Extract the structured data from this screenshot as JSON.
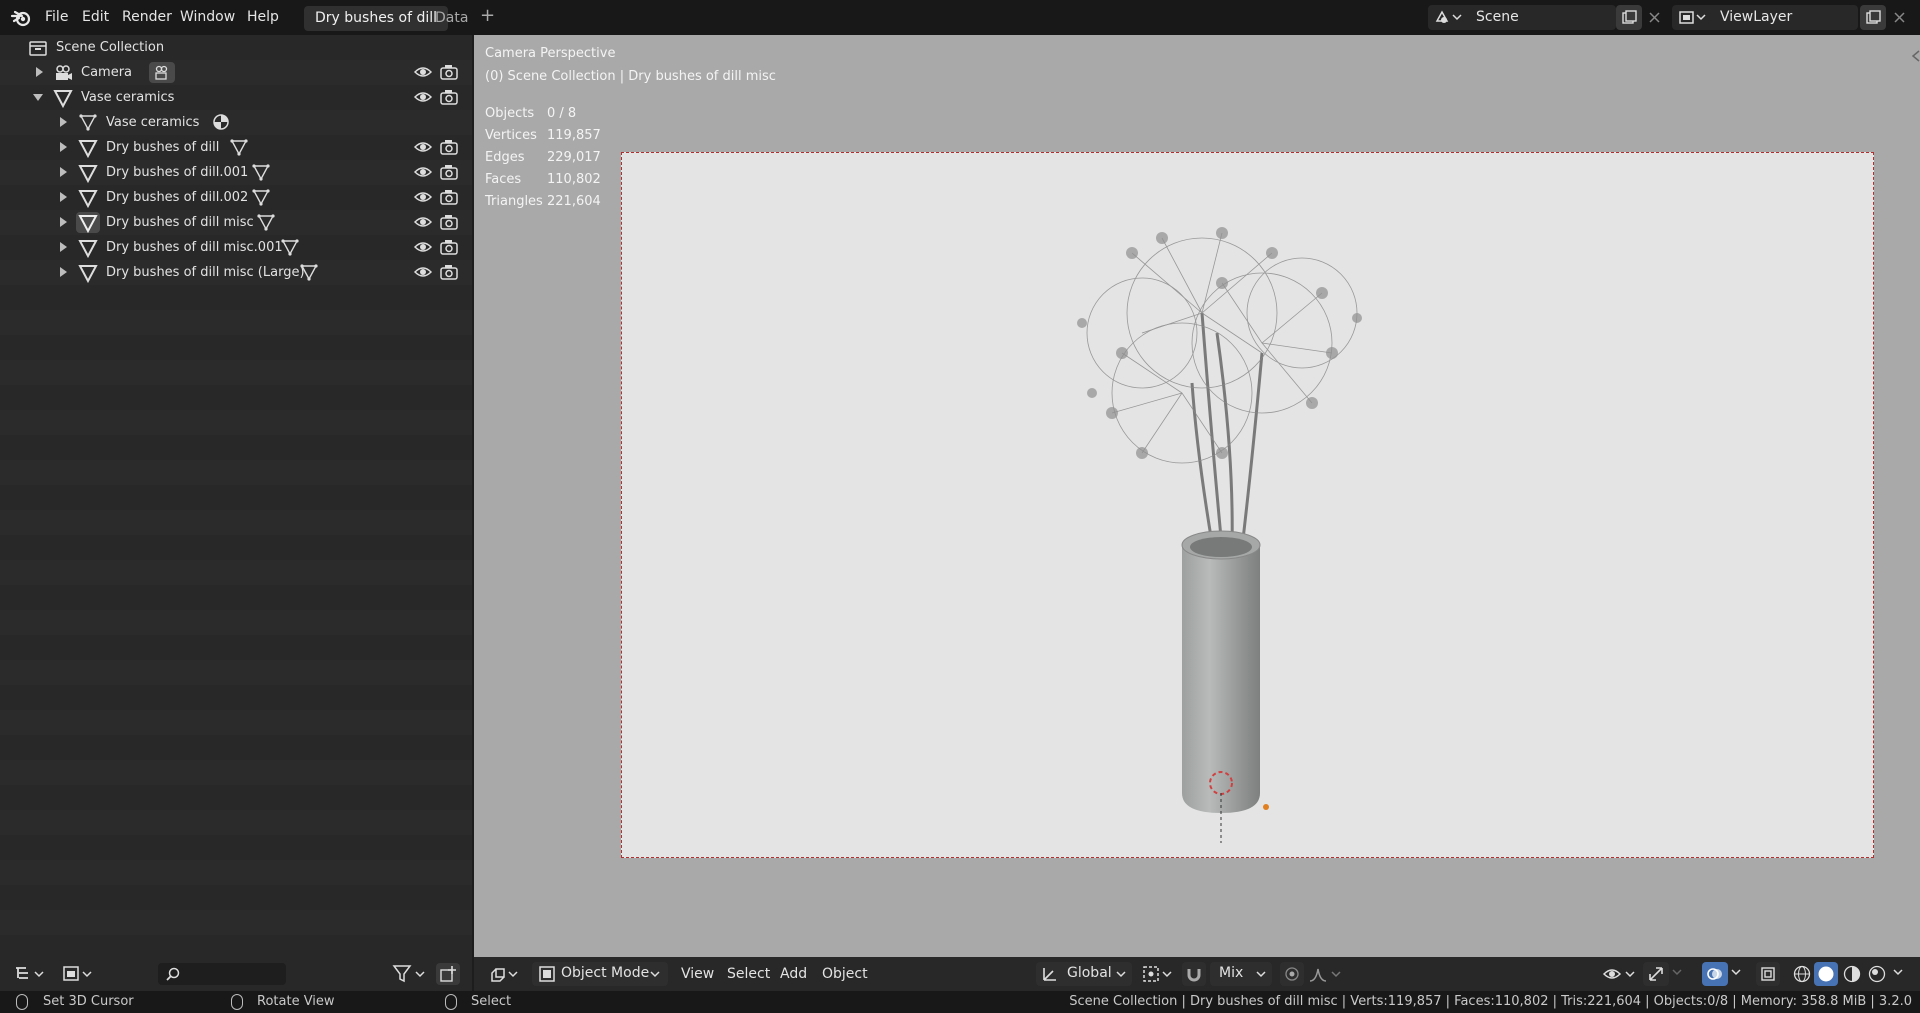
{
  "app": {
    "menu": [
      "File",
      "Edit",
      "Render",
      "Window",
      "Help"
    ],
    "workspace_tabs": [
      "Dry bushes of dill",
      "Data"
    ],
    "add_tab": "+",
    "scene_name": "Scene",
    "view_layer": "ViewLayer"
  },
  "outliner": {
    "root": "Scene Collection",
    "items": [
      {
        "label": "Camera"
      },
      {
        "label": "Vase ceramics"
      },
      {
        "label": "Vase ceramics"
      },
      {
        "label": "Dry bushes of dill"
      },
      {
        "label": "Dry bushes of dill.001"
      },
      {
        "label": "Dry bushes of dill.002"
      },
      {
        "label": "Dry bushes of dill misc"
      },
      {
        "label": "Dry bushes of dill misc.001"
      },
      {
        "label": "Dry bushes of dill misc (Large)"
      }
    ]
  },
  "viewport": {
    "title": "Camera Perspective",
    "subtitle": "(0) Scene Collection | Dry bushes of dill misc",
    "stats": [
      {
        "label": "Objects",
        "value": "0 / 8"
      },
      {
        "label": "Vertices",
        "value": "119,857"
      },
      {
        "label": "Edges",
        "value": "229,017"
      },
      {
        "label": "Faces",
        "value": "110,802"
      },
      {
        "label": "Triangles",
        "value": "221,604"
      }
    ],
    "header": {
      "mode": "Object Mode",
      "menus": [
        "View",
        "Select",
        "Add",
        "Object"
      ],
      "orientation": "Global",
      "snap_mode": "Mix"
    }
  },
  "statusbar": {
    "left_action": "Set 3D Cursor",
    "middle_action": "Rotate View",
    "right_action": "Select",
    "info": "Scene Collection | Dry bushes of dill misc | Verts:119,857 | Faces:110,802 | Tris:221,604 | Objects:0/8 | Memory: 358.8 MiB | 3.2.0"
  },
  "colors": {
    "accent": "#4772b3",
    "selection": "#333a46",
    "camera_frame": "#b03030"
  }
}
